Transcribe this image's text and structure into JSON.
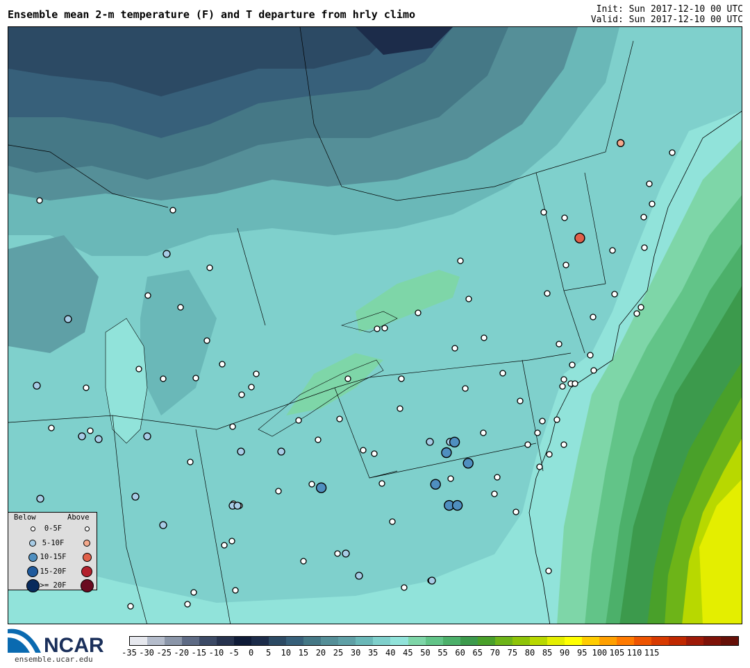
{
  "header": {
    "title": "Ensemble mean 2-m temperature (F) and T departure from hrly climo",
    "init": "Init: Sun 2017-12-10 00 UTC",
    "valid": "Valid: Sun 2017-12-10 00 UTC"
  },
  "legend": {
    "below_label": "Below",
    "above_label": "Above",
    "rows": [
      {
        "label": "0-5F",
        "below_color": "#ffffff",
        "above_color": "#ffffff"
      },
      {
        "label": "5-10F",
        "below_color": "#a8cce6",
        "above_color": "#f4a98c"
      },
      {
        "label": "10-15F",
        "below_color": "#4f8fc0",
        "above_color": "#e0604a"
      },
      {
        "label": "15-20F",
        "below_color": "#1f5a9c",
        "above_color": "#b3202c"
      },
      {
        "label": ">= 20F",
        "below_color": "#082a5c",
        "above_color": "#6a0a20"
      }
    ]
  },
  "colorbar": {
    "colors": [
      "#e6e8ee",
      "#b4bccb",
      "#8b96a9",
      "#5e6b85",
      "#3c4a66",
      "#27334f",
      "#0f1b38",
      "#1c2c4a",
      "#2c4a64",
      "#37607a",
      "#457886",
      "#558f98",
      "#5fa0a6",
      "#6ab8b8",
      "#7fd0cc",
      "#91e3da",
      "#7ed6a8",
      "#62c488",
      "#4cb06a",
      "#3c9a4c",
      "#49a02a",
      "#6db418",
      "#8ec408",
      "#b8d800",
      "#e4ee00",
      "#ffff00",
      "#ffcc00",
      "#ffa000",
      "#ff7a00",
      "#ee5400",
      "#d83a00",
      "#c02800",
      "#9e1a08",
      "#7e1208",
      "#661008"
    ],
    "tick_labels": [
      "-35",
      "-30",
      "-25",
      "-20",
      "-15",
      "-10",
      "-5",
      "0",
      "5",
      "10",
      "15",
      "20",
      "25",
      "30",
      "35",
      "40",
      "45",
      "50",
      "55",
      "60",
      "65",
      "70",
      "75",
      "80",
      "85",
      "90",
      "95",
      "100",
      "105",
      "110",
      "115"
    ]
  },
  "logo": {
    "text": "NCAR",
    "url": "ensemble.ucar.edu"
  },
  "chart_data": {
    "type": "map",
    "field": "2-m temperature (F)",
    "station_departures": [
      {
        "lon": -70.0,
        "lat": 47.3,
        "class": "above",
        "magnitude": "5-10F"
      },
      {
        "lon": -71.5,
        "lat": 44.6,
        "class": "above",
        "magnitude": "10-15F"
      },
      {
        "lon": -76.1,
        "lat": 38.8,
        "class": "below",
        "magnitude": "10-15F"
      },
      {
        "lon": -75.6,
        "lat": 38.2,
        "class": "below",
        "magnitude": "10-15F"
      },
      {
        "lon": -76.8,
        "lat": 37.6,
        "class": "below",
        "magnitude": "10-15F"
      },
      {
        "lon": -76.4,
        "lat": 38.5,
        "class": "below",
        "magnitude": "10-15F"
      },
      {
        "lon": -81.0,
        "lat": 37.5,
        "class": "below",
        "magnitude": "10-15F"
      },
      {
        "lon": -76.3,
        "lat": 37.0,
        "class": "below",
        "magnitude": "10-15F"
      },
      {
        "lon": -76.0,
        "lat": 37.0,
        "class": "below",
        "magnitude": "10-15F"
      }
    ]
  }
}
